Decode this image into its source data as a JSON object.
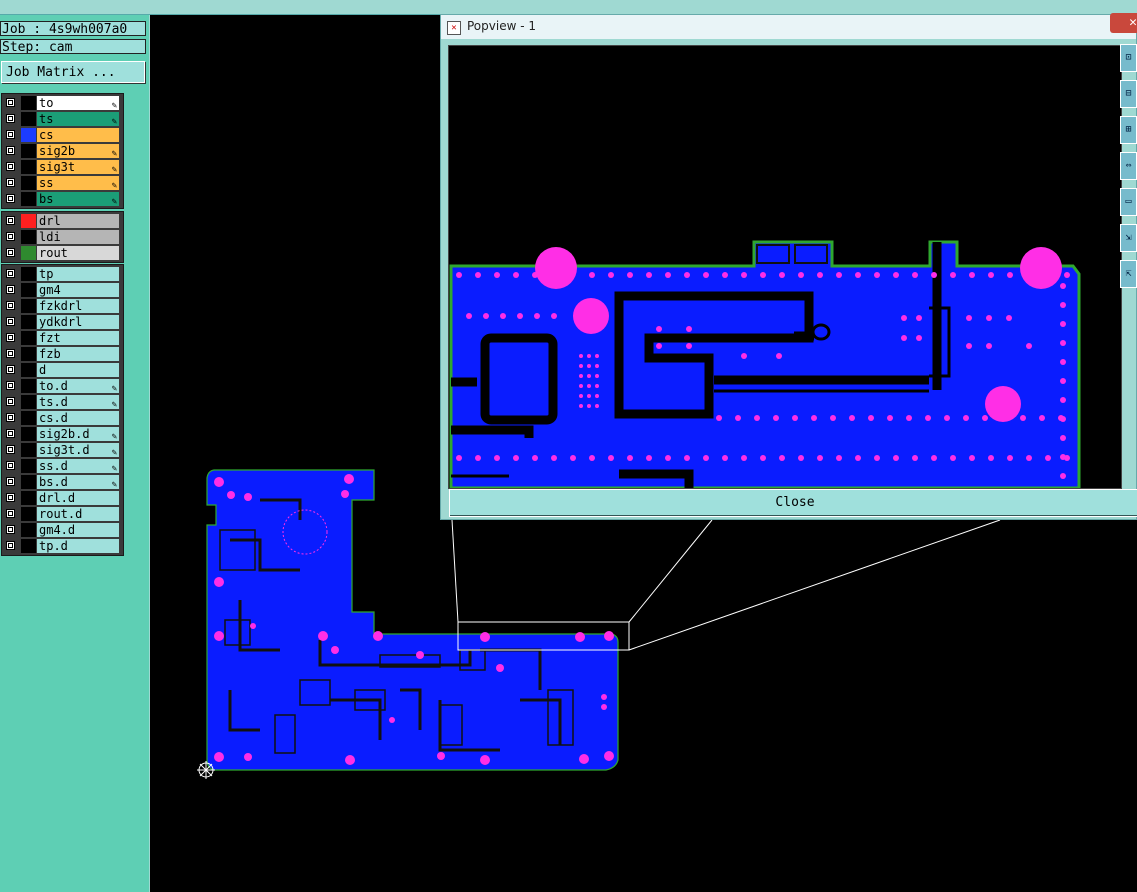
{
  "job_line": "Job : 4s9wh007a0",
  "step_line": "Step: cam",
  "job_matrix_label": "Job Matrix ...",
  "layers_board": [
    {
      "name": "to",
      "color": "#ffffff",
      "swatch": "#000000",
      "editable": true
    },
    {
      "name": "ts",
      "color": "#1b9e77",
      "swatch": "#000000",
      "editable": true
    },
    {
      "name": "cs",
      "color": "#ffbd4a",
      "swatch": "#1c3cff",
      "editable": false
    },
    {
      "name": "sig2b",
      "color": "#ffbd4a",
      "swatch": "#000000",
      "editable": true
    },
    {
      "name": "sig3t",
      "color": "#ffbd4a",
      "swatch": "#000000",
      "editable": true
    },
    {
      "name": "ss",
      "color": "#ffbd4a",
      "swatch": "#000000",
      "editable": true
    },
    {
      "name": "bs",
      "color": "#1b9e77",
      "swatch": "#000000",
      "editable": true
    }
  ],
  "layers_drill": [
    {
      "name": "drl",
      "color": "#b5b5b5",
      "swatch": "#ff2020",
      "editable": false
    },
    {
      "name": "ldi",
      "color": "#b5b5b5",
      "swatch": "#000000",
      "editable": false
    },
    {
      "name": "rout",
      "color": "#d8d8d8",
      "swatch": "#2f8a2f",
      "editable": false
    }
  ],
  "layers_misc": [
    {
      "name": "tp",
      "editable": false
    },
    {
      "name": "gm4",
      "editable": false
    },
    {
      "name": "fzkdrl",
      "editable": false
    },
    {
      "name": "ydkdrl",
      "editable": false
    },
    {
      "name": "fzt",
      "editable": false
    },
    {
      "name": "fzb",
      "editable": false
    },
    {
      "name": "d",
      "editable": false
    },
    {
      "name": "to.d",
      "editable": true
    },
    {
      "name": "ts.d",
      "editable": true
    },
    {
      "name": "cs.d",
      "editable": false
    },
    {
      "name": "sig2b.d",
      "editable": true
    },
    {
      "name": "sig3t.d",
      "editable": true
    },
    {
      "name": "ss.d",
      "editable": true
    },
    {
      "name": "bs.d",
      "editable": true
    },
    {
      "name": "drl.d",
      "editable": false
    },
    {
      "name": "rout.d",
      "editable": false
    },
    {
      "name": "gm4.d",
      "editable": false
    },
    {
      "name": "tp.d",
      "editable": false
    }
  ],
  "popup": {
    "title": "Popview - 1",
    "close_label": "Close",
    "close_x": "✕"
  },
  "colors": {
    "copper": "#0a1cff",
    "pad": "#ff2ee6",
    "outline": "#2fa82f",
    "panel_bg": "#5ecfb4"
  },
  "icons": [
    "popup-window-icon",
    "pin-icon",
    "zoom-tool-icon"
  ]
}
